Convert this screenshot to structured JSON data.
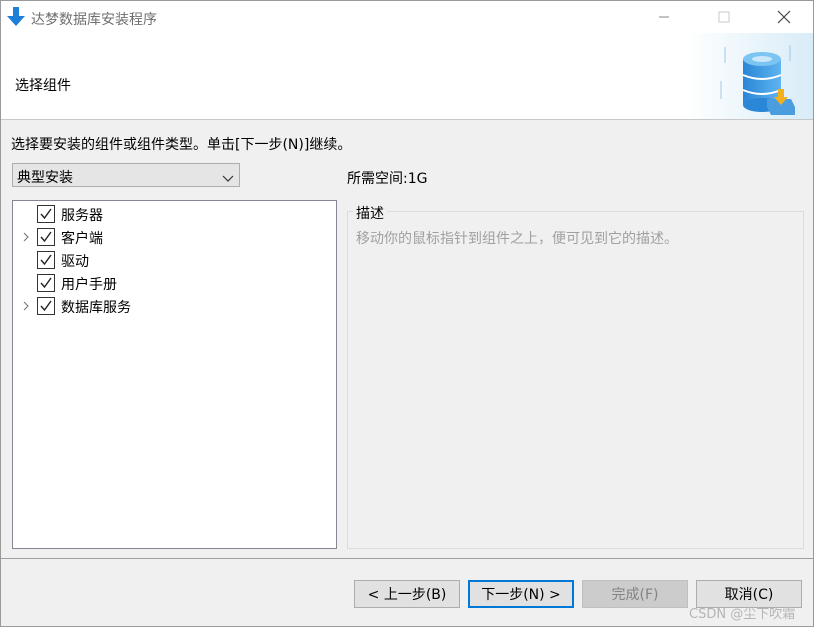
{
  "window": {
    "title": "达梦数据库安装程序"
  },
  "header": {
    "title": "选择组件"
  },
  "instruction": "选择要安装的组件或组件类型。单击[下一步(N)]继续。",
  "install_type": {
    "selected": "典型安装"
  },
  "space_required": "所需空间:1G",
  "components": [
    {
      "label": "服务器",
      "checked": true,
      "expandable": false
    },
    {
      "label": "客户端",
      "checked": true,
      "expandable": true
    },
    {
      "label": "驱动",
      "checked": true,
      "expandable": false
    },
    {
      "label": "用户手册",
      "checked": true,
      "expandable": false
    },
    {
      "label": "数据库服务",
      "checked": true,
      "expandable": true
    }
  ],
  "description": {
    "title": "描述",
    "text": "移动你的鼠标指针到组件之上，便可见到它的描述。"
  },
  "buttons": {
    "back": "< 上一步(B)",
    "next": "下一步(N) >",
    "finish": "完成(F)",
    "cancel": "取消(C)"
  },
  "watermark": "CSDN @尘下吹霜",
  "colors": {
    "accent": "#0078d7",
    "title_text": "#6f6f6f",
    "desc_text": "#a0a0a0"
  },
  "icons": {
    "app": "download-arrow-icon",
    "minimize": "minimize-icon",
    "maximize": "maximize-icon",
    "close": "close-icon",
    "header_graphic": "database-install-icon",
    "expander": "chevron-right-icon",
    "checkbox": "checkmark-icon",
    "dropdown": "chevron-down-icon"
  }
}
